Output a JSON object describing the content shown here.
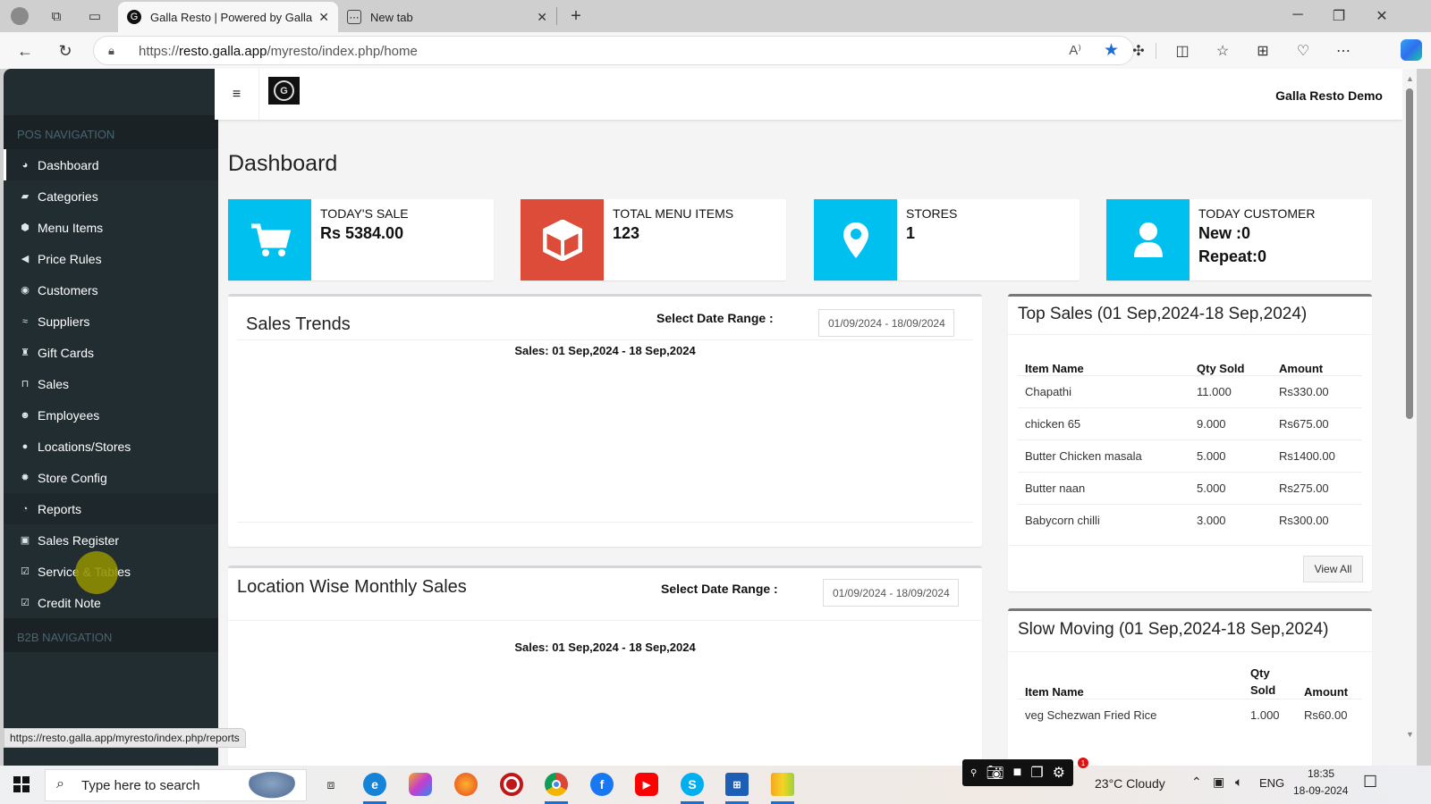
{
  "browser": {
    "tabs": [
      {
        "title": "Galla Resto | Powered by Galla",
        "active": true
      },
      {
        "title": "New tab",
        "active": false
      }
    ],
    "url_prefix": "https://",
    "url_host": "resto.galla.app",
    "url_path": "/myresto/index.php/home",
    "status_url": "https://resto.galla.app/myresto/index.php/reports"
  },
  "header": {
    "user": "Galla Resto Demo"
  },
  "sidebar": {
    "section_pos": "POS NAVIGATION",
    "section_b2b": "B2B NAVIGATION",
    "items": [
      {
        "label": "Dashboard",
        "icon": "dashboard-icon",
        "glyph": "◕",
        "state": "active"
      },
      {
        "label": "Categories",
        "icon": "folder-open-icon",
        "glyph": "▰",
        "state": ""
      },
      {
        "label": "Menu Items",
        "icon": "cube-icon",
        "glyph": "⬢",
        "state": ""
      },
      {
        "label": "Price Rules",
        "icon": "bullhorn-icon",
        "glyph": "◀",
        "state": ""
      },
      {
        "label": "Customers",
        "icon": "user-circle-icon",
        "glyph": "◉",
        "state": ""
      },
      {
        "label": "Suppliers",
        "icon": "handshake-icon",
        "glyph": "≈",
        "state": ""
      },
      {
        "label": "Gift Cards",
        "icon": "gift-icon",
        "glyph": "♜",
        "state": ""
      },
      {
        "label": "Sales",
        "icon": "basket-icon",
        "glyph": "⊓",
        "state": ""
      },
      {
        "label": "Employees",
        "icon": "users-icon",
        "glyph": "☻",
        "state": ""
      },
      {
        "label": "Locations/Stores",
        "icon": "map-marker-icon",
        "glyph": "●",
        "state": ""
      },
      {
        "label": "Store Config",
        "icon": "cog-icon",
        "glyph": "✹",
        "state": ""
      },
      {
        "label": "Reports",
        "icon": "pie-chart-icon",
        "glyph": "◔",
        "state": "hover"
      },
      {
        "label": "Sales Register",
        "icon": "money-icon",
        "glyph": "▣",
        "state": ""
      },
      {
        "label": "Service & Tables",
        "icon": "check-square-icon",
        "glyph": "☑",
        "state": ""
      },
      {
        "label": "Credit Note",
        "icon": "check-square-icon",
        "glyph": "☑",
        "state": ""
      }
    ]
  },
  "page": {
    "title": "Dashboard"
  },
  "stats": [
    {
      "label": "TODAY'S SALE",
      "value": "Rs 5384.00",
      "value2": "",
      "color": "#00c0ef",
      "icon": "shopping-cart-icon"
    },
    {
      "label": "TOTAL MENU ITEMS",
      "value": "123",
      "value2": "",
      "color": "#dd4b39",
      "icon": "cube-icon"
    },
    {
      "label": "STORES",
      "value": "1",
      "value2": "",
      "color": "#00c0ef",
      "icon": "map-marker-icon"
    },
    {
      "label": "TODAY CUSTOMER",
      "value": "New :0",
      "value2": "Repeat:0",
      "color": "#00c0ef",
      "icon": "user-icon"
    }
  ],
  "sales_trends": {
    "title": "Sales Trends",
    "date_label": "Select Date Range :",
    "date_value": "01/09/2024 - 18/09/2024",
    "caption": "Sales: 01 Sep,2024 - 18 Sep,2024"
  },
  "location_sales": {
    "title": "Location Wise Monthly Sales",
    "date_label": "Select Date Range :",
    "date_value": "01/09/2024 - 18/09/2024",
    "caption": "Sales: 01 Sep,2024 - 18 Sep,2024"
  },
  "top_sales": {
    "title": "Top Sales (01 Sep,2024-18 Sep,2024)",
    "columns": [
      "Item Name",
      "Qty Sold",
      "Amount"
    ],
    "rows": [
      [
        "Chapathi",
        "11.000",
        "Rs330.00"
      ],
      [
        "chicken 65",
        "9.000",
        "Rs675.00"
      ],
      [
        "Butter Chicken masala",
        "5.000",
        "Rs1400.00"
      ],
      [
        "Butter naan",
        "5.000",
        "Rs275.00"
      ],
      [
        "Babycorn chilli",
        "3.000",
        "Rs300.00"
      ]
    ],
    "view_all": "View All"
  },
  "slow_moving": {
    "title": "Slow Moving (01 Sep,2024-18 Sep,2024)",
    "columns": [
      "Item Name",
      "Qty Sold",
      "Amount"
    ],
    "rows": [
      [
        "veg Schezwan Fried Rice",
        "1.000",
        "Rs60.00"
      ]
    ]
  },
  "taskbar": {
    "search_placeholder": "Type here to search",
    "weather": "23°C  Cloudy",
    "notification_count": "1",
    "language": "ENG",
    "time": "18:35",
    "date": "18-09-2024"
  }
}
